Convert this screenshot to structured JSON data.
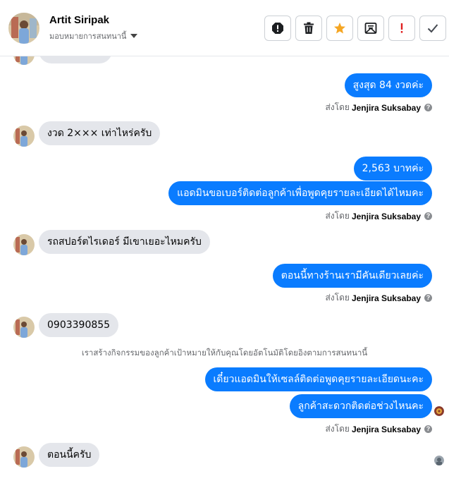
{
  "header": {
    "contact_name": "Artit Siripak",
    "assign_label": "มอบหมายการสนทนานี้"
  },
  "actions": [
    {
      "name": "report-spam-icon"
    },
    {
      "name": "trash-icon"
    },
    {
      "name": "star-icon"
    },
    {
      "name": "mark-unread-icon"
    },
    {
      "name": "important-icon"
    },
    {
      "name": "check-icon"
    }
  ],
  "messages": {
    "m1": "สูงสุด 84 งวดค่ะ",
    "m2": "งวด 2××× เท่าไหร่ครับ",
    "m3": "2,563 บาทค่ะ",
    "m4": "แอดมินขอเบอร์ติดต่อลูกค้าเพื่อพูดคุยรายละเอียดได้ไหมคะ",
    "m5": "รถสปอร์ตไรเดอร์ มีเขาเยอะไหมครับ",
    "m6": "ตอนนี้ทางร้านเรามีคันเดียวเลยค่ะ",
    "m7": "0903390855",
    "m8": "เดี๋ยวแอดมินให้เซลล์ติดต่อพูดคุยรายละเอียดนะคะ",
    "m9": "ลูกค้าสะดวกติดต่อช่วงไหนคะ",
    "m10": "ตอนนี้ครับ"
  },
  "sent_by_prefix": "ส่งโดย",
  "sent_by_name": "Jenjira Suksabay",
  "system_note": "เราสร้างกิจกรรมของลูกค้าเป้าหมายให้กับคุณโดยอัตโนมัติโดยอิงตามการสนทนานี้",
  "colors": {
    "outgoing_bubble": "#0a7cff",
    "incoming_bubble": "#e4e6eb",
    "star": "#f5a623",
    "important": "#e02020"
  }
}
